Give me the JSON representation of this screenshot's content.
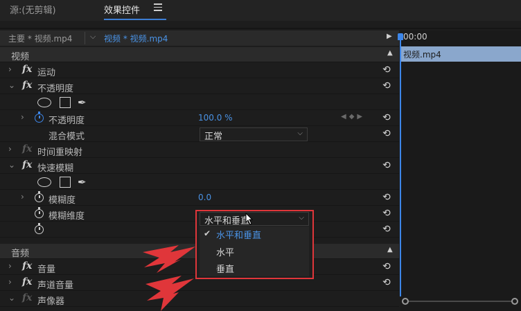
{
  "panel": {
    "tabs": [
      {
        "label": "源:(无剪辑)"
      },
      {
        "label": "效果控件"
      }
    ]
  },
  "sequence": {
    "main": "主要 * 视频.mp4",
    "active": "视频 * 视频.mp4"
  },
  "timeline": {
    "time": "00:00",
    "clip": "视频.mp4"
  },
  "sections": {
    "video": "视频",
    "audio": "音频"
  },
  "effects": {
    "motion": "运动",
    "opacity": "不透明度",
    "opacity_prop": "不透明度",
    "opacity_value": "100.0 %",
    "blend_mode": "混合模式",
    "blend_value": "正常",
    "time_remap": "时间重映射",
    "fast_blur": "快速模糊",
    "blurriness": "模糊度",
    "blurriness_value": "0.0",
    "blur_dimensions": "模糊维度",
    "blur_dimensions_value": "水平和垂直",
    "volume": "音量",
    "channel_volume": "声道音量",
    "panner": "声像器"
  },
  "dropdown": {
    "options": [
      {
        "label": "水平和垂直",
        "selected": true
      },
      {
        "label": "水平",
        "selected": false
      },
      {
        "label": "垂直",
        "selected": false
      }
    ]
  },
  "colors": {
    "accent": "#3d86e8",
    "highlight_box": "#e0363a",
    "clip": "#8aa7cc"
  },
  "icons": [
    "fx-icon",
    "stopwatch-icon",
    "reset-icon",
    "ellipse-mask-icon",
    "rectangle-mask-icon",
    "pen-mask-icon",
    "chevron-icon",
    "checkmark-icon"
  ]
}
